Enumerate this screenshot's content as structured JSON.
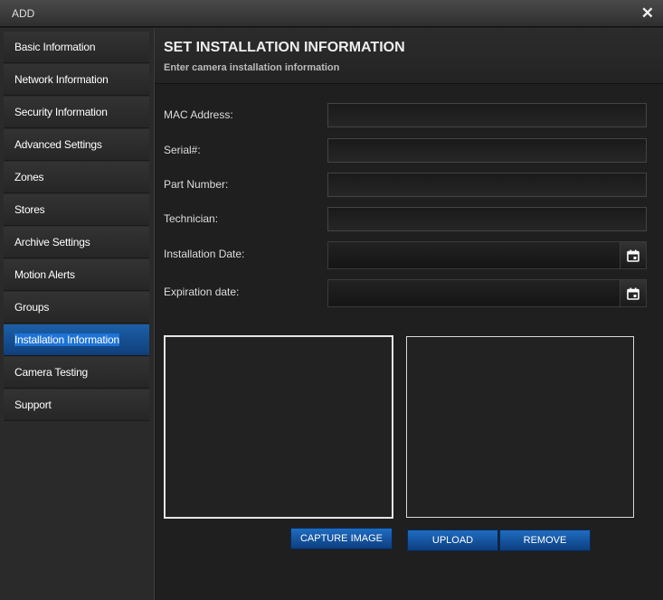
{
  "window": {
    "title": "ADD",
    "close_icon": "close-icon"
  },
  "sidebar": {
    "items": [
      {
        "label": "Basic Information"
      },
      {
        "label": "Network Information"
      },
      {
        "label": "Security Information"
      },
      {
        "label": "Advanced Settings"
      },
      {
        "label": "Zones"
      },
      {
        "label": "Stores"
      },
      {
        "label": "Archive Settings"
      },
      {
        "label": "Motion Alerts"
      },
      {
        "label": "Groups"
      },
      {
        "label": "Installation Information"
      },
      {
        "label": "Camera Testing"
      },
      {
        "label": "Support"
      }
    ],
    "active_index": 9
  },
  "header": {
    "title": "SET INSTALLATION INFORMATION",
    "subtitle": "Enter camera installation information"
  },
  "form": {
    "mac_label": "MAC Address:",
    "mac_value": "",
    "serial_label": "Serial#:",
    "serial_value": "",
    "part_label": "Part Number:",
    "part_value": "",
    "tech_label": "Technician:",
    "tech_value": "",
    "install_date_label": "Installation Date:",
    "install_date_value": "",
    "expiration_label": "Expiration date:",
    "expiration_value": ""
  },
  "buttons": {
    "capture": "CAPTURE IMAGE",
    "upload": "UPLOAD",
    "remove": "REMOVE"
  },
  "colors": {
    "accent": "#1e73d6",
    "background": "#1f1f1f"
  }
}
